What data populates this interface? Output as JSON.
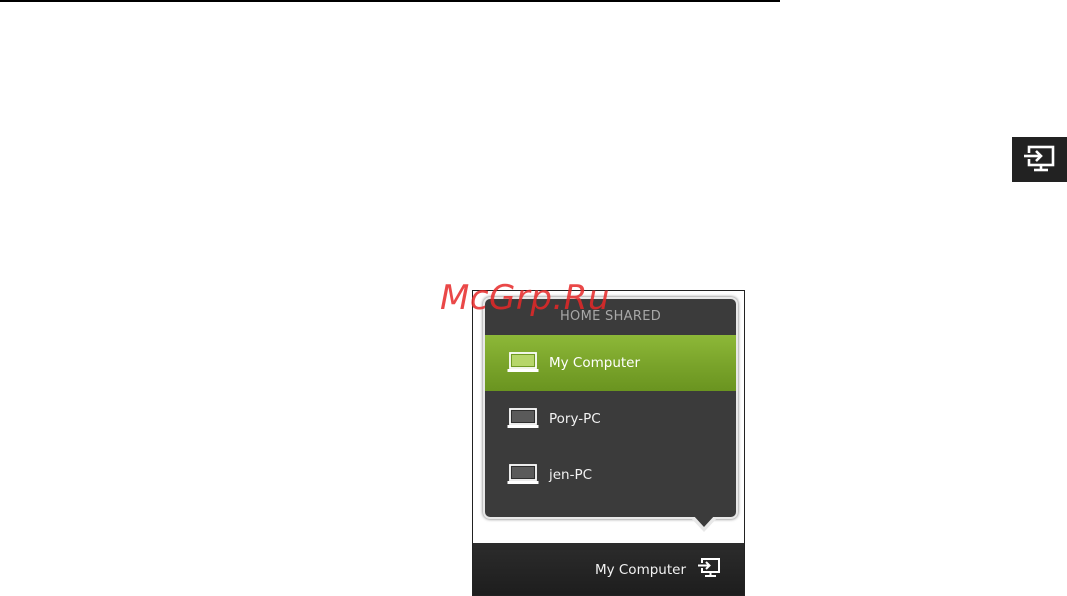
{
  "standalone_icon": "play-to-icon",
  "popup": {
    "header": "HOME SHARED",
    "items": [
      {
        "label": "My Computer",
        "icon": "laptop-icon",
        "selected": true
      },
      {
        "label": "Pory-PC",
        "icon": "laptop-icon",
        "selected": false
      },
      {
        "label": "jen-PC",
        "icon": "laptop-icon",
        "selected": false
      }
    ]
  },
  "taskbar": {
    "label": "My Computer",
    "icon": "play-to-icon"
  },
  "watermark": "McGrp.Ru",
  "colors": {
    "accent": "#7fa82e",
    "popup_bg": "#3b3b3b",
    "taskbar_bg": "#232323",
    "watermark": "#e62828"
  }
}
